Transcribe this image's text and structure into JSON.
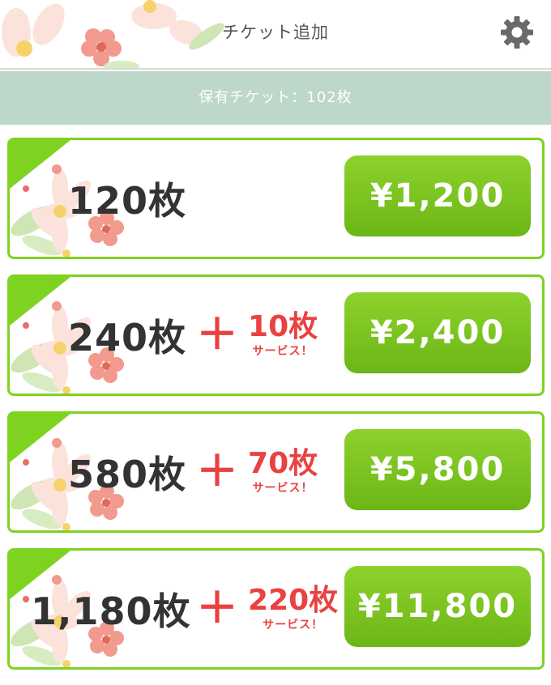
{
  "header": {
    "title": "チケット追加",
    "settings_icon": "gear-icon"
  },
  "status": {
    "text": "保有チケット：102枚"
  },
  "colors": {
    "accent_green": "#7dd320",
    "button_green": "#7cc423",
    "bonus_red": "#ea4141",
    "status_bar": "#bdd7ca"
  },
  "packages": [
    {
      "quantity": "120枚",
      "price": "¥1,200"
    },
    {
      "quantity": "240枚",
      "plus": "＋",
      "bonus": "10枚",
      "bonus_label": "サービス！",
      "price": "¥2,400"
    },
    {
      "quantity": "580枚",
      "plus": "＋",
      "bonus": "70枚",
      "bonus_label": "サービス！",
      "price": "¥5,800"
    },
    {
      "quantity": "1,180枚",
      "plus": "＋",
      "bonus": "220枚",
      "bonus_label": "サービス！",
      "price": "¥11,800"
    }
  ]
}
